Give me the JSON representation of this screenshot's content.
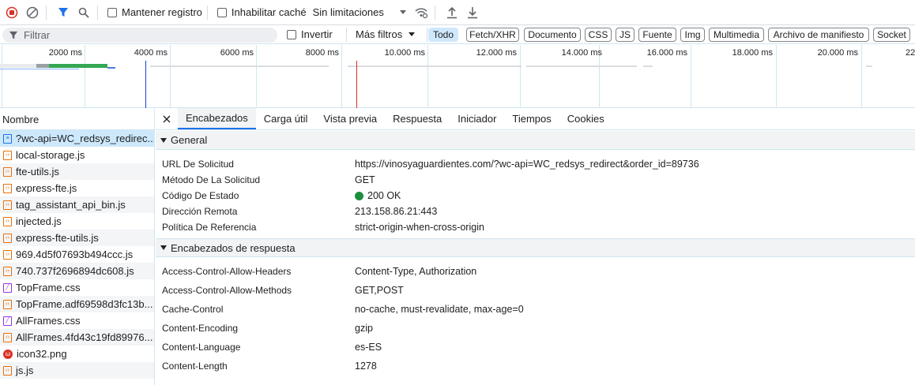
{
  "toolbar": {
    "preserve_log": "Mantener registro",
    "disable_cache": "Inhabilitar caché",
    "throttling": "Sin limitaciones"
  },
  "filterbar": {
    "filter_placeholder": "Filtrar",
    "invert": "Invertir",
    "more_filters": "Más filtros",
    "types": [
      "Todo",
      "Fetch/XHR",
      "Documento",
      "CSS",
      "JS",
      "Fuente",
      "Img",
      "Multimedia",
      "Archivo de manifiesto",
      "Socket"
    ]
  },
  "timeline": {
    "ticks": [
      "2000 ms",
      "4000 ms",
      "6000 ms",
      "8000 ms",
      "10.000 ms",
      "12.000 ms",
      "14.000 ms",
      "16.000 ms",
      "18.000 ms",
      "20.000 ms",
      "22"
    ]
  },
  "request_list": {
    "header": "Nombre",
    "items": [
      {
        "name": "?wc-api=WC_redsys_redirec...",
        "type": "doc"
      },
      {
        "name": "local-storage.js",
        "type": "js"
      },
      {
        "name": "fte-utils.js",
        "type": "js"
      },
      {
        "name": "express-fte.js",
        "type": "js"
      },
      {
        "name": "tag_assistant_api_bin.js",
        "type": "js"
      },
      {
        "name": "injected.js",
        "type": "js"
      },
      {
        "name": "express-fte-utils.js",
        "type": "js"
      },
      {
        "name": "969.4d5f07693b494ccc.js",
        "type": "js"
      },
      {
        "name": "740.737f2696894dc608.js",
        "type": "js"
      },
      {
        "name": "TopFrame.css",
        "type": "css"
      },
      {
        "name": "TopFrame.adf69598d3fc13b...",
        "type": "js"
      },
      {
        "name": "AllFrames.css",
        "type": "css"
      },
      {
        "name": "AllFrames.4fd43c19fd89976...",
        "type": "js"
      },
      {
        "name": "icon32.png",
        "type": "img"
      },
      {
        "name": "js.js",
        "type": "js"
      }
    ]
  },
  "details": {
    "tabs": [
      "Encabezados",
      "Carga útil",
      "Vista previa",
      "Respuesta",
      "Iniciador",
      "Tiempos",
      "Cookies"
    ],
    "general": {
      "title": "General",
      "rows": [
        {
          "k": "URL De Solicitud",
          "v": "https://vinosyaguardientes.com/?wc-api=WC_redsys_redirect&order_id=89736"
        },
        {
          "k": "Método De La Solicitud",
          "v": "GET"
        },
        {
          "k": "Código De Estado",
          "v": "200 OK"
        },
        {
          "k": "Dirección Remota",
          "v": "213.158.86.21:443"
        },
        {
          "k": "Política De Referencia",
          "v": "strict-origin-when-cross-origin"
        }
      ]
    },
    "response_headers": {
      "title": "Encabezados de respuesta",
      "rows": [
        {
          "k": "Access-Control-Allow-Headers",
          "v": "Content-Type, Authorization"
        },
        {
          "k": "Access-Control-Allow-Methods",
          "v": "GET,POST"
        },
        {
          "k": "Cache-Control",
          "v": "no-cache, must-revalidate, max-age=0"
        },
        {
          "k": "Content-Encoding",
          "v": "gzip"
        },
        {
          "k": "Content-Language",
          "v": "es-ES"
        },
        {
          "k": "Content-Length",
          "v": "1278"
        }
      ]
    }
  },
  "colors": {
    "accent": "#1a73e8",
    "status_ok": "#1e8e3e",
    "record": "#d93025"
  }
}
